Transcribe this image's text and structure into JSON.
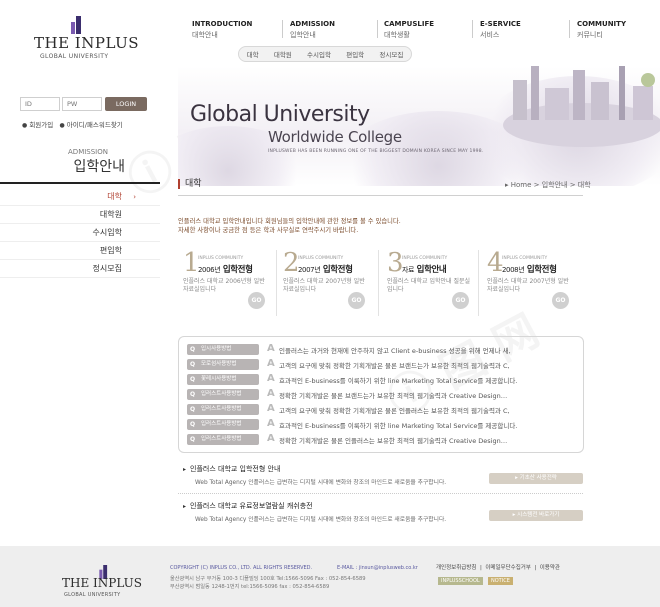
{
  "brand": {
    "name": "THE INPLUS",
    "sub": "GLOBAL UNIVERSITY"
  },
  "gnb": [
    {
      "en": "INTRODUCTION",
      "ko": "대학안내"
    },
    {
      "en": "ADMISSION",
      "ko": "입학안내"
    },
    {
      "en": "CAMPUSLIFE",
      "ko": "대학생활"
    },
    {
      "en": "E-SERVICE",
      "ko": "서비스"
    },
    {
      "en": "COMMUNITY",
      "ko": "커뮤니티"
    }
  ],
  "subnav": [
    "대학",
    "대학원",
    "수시입학",
    "편입학",
    "정시모집"
  ],
  "banner": {
    "title": "Global University",
    "subtitle": "Worldwide College",
    "tagline": "INPLUSWEB HAS BEEN RUNNING ONE OF THE BIGGEST DOMAIN KOREA SINCE MAY 1998."
  },
  "login": {
    "id_placeholder": "ID",
    "pw_placeholder": "PW",
    "button": "LOGIN",
    "join": "회원가입",
    "find": "아이디/패스워드찾기"
  },
  "side": {
    "title_en": "ADMISSION",
    "title_ko": "입학안내",
    "items": [
      {
        "label": "대학",
        "arrow": "›"
      },
      {
        "label": "대학원"
      },
      {
        "label": "수시입학"
      },
      {
        "label": "편입학"
      },
      {
        "label": "정시모집"
      }
    ]
  },
  "content": {
    "title": "대학",
    "breadcrumb": "▸ Home  >  입학안내  >  대학",
    "intro": [
      "인플러스 대학교 입학안내입니다 회원님들의 입학안내에 관한 정보를 볼 수 있습니다.",
      "자세한 사항이나 궁금한 점 등은 학과 사무실로 연락주시기 바랍니다."
    ],
    "steps": [
      {
        "num": "1",
        "comm": "INPLUS COMMUNITY",
        "year": "2006년",
        "title": "입학전형",
        "desc": "인플러스 대학교 2006년형 일반자료실입니다",
        "go": "GO"
      },
      {
        "num": "2",
        "comm": "INPLUS COMMUNITY",
        "year": "2007년",
        "title": "입학전형",
        "desc": "인플러스 대학교 2007년형 일반자료실입니다",
        "go": "GO"
      },
      {
        "num": "3",
        "comm": "INPLUS COMMUNITY",
        "year": "자료",
        "title": "입학안내",
        "desc": "인플러스 대학교 입학안내 질문실입니다",
        "go": "GO"
      },
      {
        "num": "4",
        "comm": "INPLUS COMMUNITY",
        "year": "2008년",
        "title": "입학전형",
        "desc": "인플러스 대학교 2007년형 일반자료실입니다",
        "go": "GO"
      }
    ],
    "faq": [
      {
        "q": "입시사용방법",
        "a": "A",
        "text": "인플러스는 과거와 현재에 안주하지 않고 Client e-business 성공을 위해 언제나 새,"
      },
      {
        "q": "모로섬사용방법",
        "a": "A",
        "text": "고객의 요구에 맞춰 정확한 기획개발은 물론 브랜드는가 보유한 최적의 웹기술력과 C,"
      },
      {
        "q": "꽃레시사용방법",
        "a": "A",
        "text": "효과적인 E-business를 이룩하기 위한 line Marketing Total Service를 제공합니다."
      },
      {
        "q": "입러스트사용방법",
        "a": "A",
        "text": "정확한 기획개발은 물론 브랜드는가 보유한 최적의 웹기술력과 Creative Design…"
      },
      {
        "q": "입러스트사용방법",
        "a": "A",
        "text": "고객의 요구에 맞춰 정확한 기획개발은 물론 인플러스는 보유한 최적의 웹기술력과 C,"
      },
      {
        "q": "입러스트사용방법",
        "a": "A",
        "text": "효과적인 E-business를 이룩하기 위한 line Marketing Total Service를 제공합니다."
      },
      {
        "q": "입러스트사용방법",
        "a": "A",
        "text": "정확한 기획개발은 물론 인플러스는 보유한 최적의 웹기술력과 Creative Design…"
      }
    ],
    "notices": [
      {
        "title": "인플러스 대학교 입학전형 안내",
        "desc": "Web Total Agency 인플러스는 급변하는 디지털 시대에 변화와 창조의 마인드로 새로움을 추구합니다.",
        "button": "▸ 기초산 사용전략"
      },
      {
        "title": "인플러스 대학교 유료정보열람실 캐쉬충전",
        "desc": "Web Total Agency 인플러스는 급변하는 디지털 시대에 변화와 창조의 마인드로 새로움을 추구합니다.",
        "button": "▸ 시스템전 바로가기"
      }
    ]
  },
  "footer": {
    "copyright": "COPYRIGHT (C) INPLUS CO., LTD. ALL RIGHTS RESERVED.",
    "email": "E-MAIL : jinsun@inplusweb.co.kr",
    "address": [
      "울산광역시 남구 무거동 100-3 디플빌딩 100호  Tel:1566-5096  Fax : 052-854-6589",
      "부산광역시 범일동 1248-1번지  tel:1566-5096  fax : 052-854-6589"
    ],
    "links": [
      "개인정보취급방침",
      "이메일무단수집거부",
      "이용약관"
    ],
    "badges": [
      "INPLUSSCHOOL",
      "NOTICE"
    ]
  },
  "colors": {
    "accent": "#b04030",
    "button_brown": "#7a6a60",
    "gray_button": "#d6cfc4"
  }
}
